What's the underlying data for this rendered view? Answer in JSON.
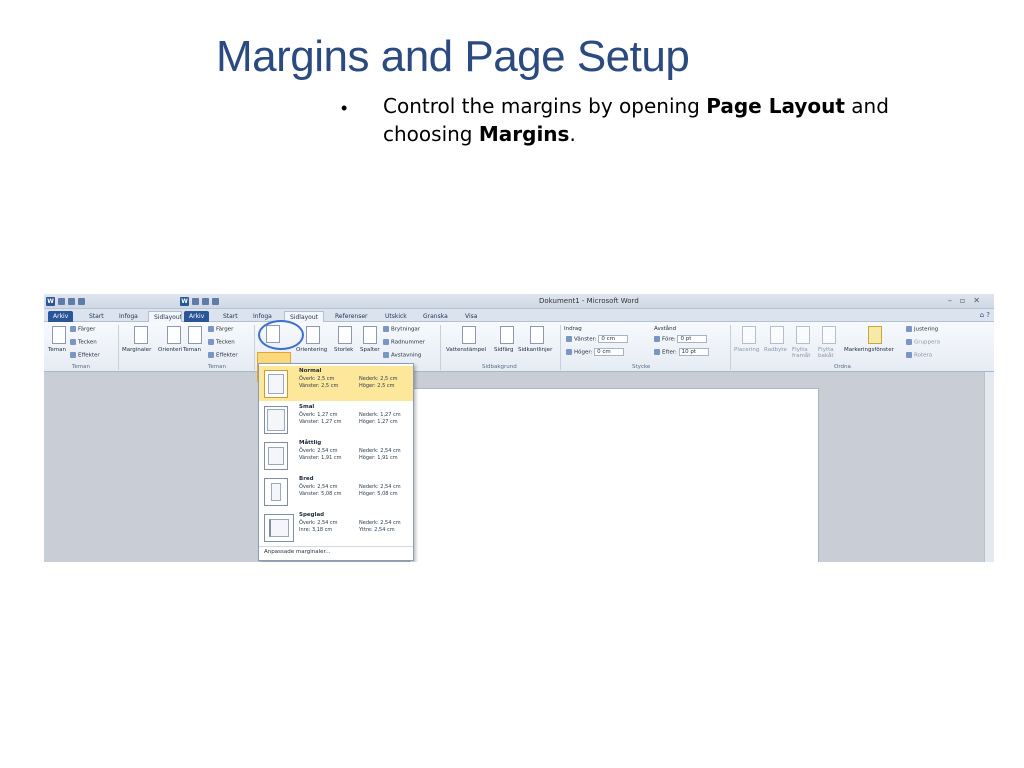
{
  "slide": {
    "title": "Margins and Page Setup",
    "bullet_pre": "Control the margins by opening ",
    "bullet_b1": "Page Layout",
    "bullet_mid": " and choosing ",
    "bullet_b2": "Margins",
    "bullet_end": "."
  },
  "word": {
    "document_title": "Dokument1 - Microsoft Word",
    "tabs_left": [
      "Arkiv",
      "Start",
      "Infoga",
      "Sidlayout"
    ],
    "tabs_right": [
      "Arkiv",
      "Start",
      "Infoga",
      "Sidlayout",
      "Referenser",
      "Utskick",
      "Granska",
      "Visa"
    ],
    "ribbon": {
      "teman": "Teman",
      "farger": "Färger",
      "tecken": "Tecken",
      "effekter": "Effekter",
      "marginaler": "Marginaler",
      "orientering_short": "Orientering",
      "orientering": "Orientering",
      "storlek": "Storlek",
      "spalter": "Spalter",
      "brytningar": "Brytningar",
      "radnummer": "Radnummer",
      "avstavning": "Avstavning",
      "vattenstampel": "Vattenstämpel",
      "sidfarg": "Sidfärg",
      "sidkantlinjer": "Sidkantlinjer",
      "sidbakgrund": "Sidbakgrund",
      "indrag": "Indrag",
      "vanster_label": "Vänster:",
      "vanster_value": "0 cm",
      "hoger_label": "Höger:",
      "hoger_value": "0 cm",
      "avstand": "Avstånd",
      "fore_label": "Före:",
      "fore_value": "0 pt",
      "efter_label": "Efter:",
      "efter_value": "10 pt",
      "stycke": "Stycke",
      "placering": "Placering",
      "radbyte": "Radbyte",
      "flytta_fram": "Flytta framåt",
      "flytta_bak": "Flytta bakåt",
      "markeringsfonster": "Markeringsfönster",
      "justering": "Justering",
      "gruppera": "Gruppera",
      "rotera": "Rotera",
      "ordna": "Ordna"
    },
    "margins_menu": {
      "items": [
        {
          "name": "Normal",
          "r1": "Överk: 2,5 cm",
          "r1b": "Nederk: 2,5 cm",
          "r2": "Vänster: 2,5 cm",
          "r2b": "Höger: 2,5 cm"
        },
        {
          "name": "Smal",
          "r1": "Överk: 1,27 cm",
          "r1b": "Nederk: 1,27 cm",
          "r2": "Vänster: 1,27 cm",
          "r2b": "Höger: 1,27 cm"
        },
        {
          "name": "Måttlig",
          "r1": "Överk: 2,54 cm",
          "r1b": "Nederk: 2,54 cm",
          "r2": "Vänster: 1,91 cm",
          "r2b": "Höger: 1,91 cm"
        },
        {
          "name": "Bred",
          "r1": "Överk: 2,54 cm",
          "r1b": "Nederk: 2,54 cm",
          "r2": "Vänster: 5,08 cm",
          "r2b": "Höger: 5,08 cm"
        },
        {
          "name": "Speglad",
          "r1": "Överk: 2,54 cm",
          "r1b": "Nederk: 2,54 cm",
          "r2": "Inre: 3,18 cm",
          "r2b": "Yttre: 2,54 cm"
        }
      ],
      "custom": "Anpassade marginaler..."
    }
  }
}
